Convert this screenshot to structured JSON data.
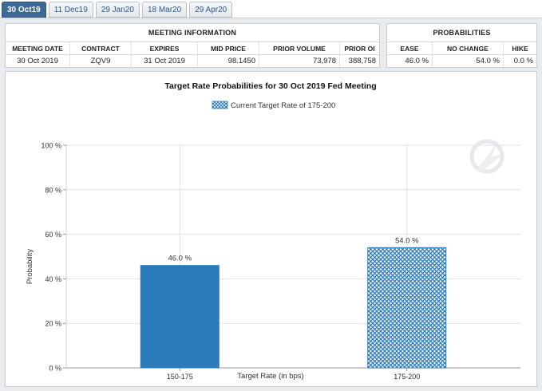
{
  "tabs": [
    {
      "label": "30 Oct19",
      "active": true
    },
    {
      "label": "11 Dec19",
      "active": false
    },
    {
      "label": "29 Jan20",
      "active": false
    },
    {
      "label": "18 Mar20",
      "active": false
    },
    {
      "label": "29 Apr20",
      "active": false
    }
  ],
  "meeting_info": {
    "title": "MEETING INFORMATION",
    "headers": [
      "MEETING DATE",
      "CONTRACT",
      "EXPIRES",
      "MID PRICE",
      "PRIOR VOLUME",
      "PRIOR OI"
    ],
    "row": [
      "30 Oct 2019",
      "ZQV9",
      "31 Oct 2019",
      "98.1450",
      "73,978",
      "388,758"
    ]
  },
  "probabilities": {
    "title": "PROBABILITIES",
    "headers": [
      "EASE",
      "NO CHANGE",
      "HIKE"
    ],
    "row": [
      "46.0 %",
      "54.0 %",
      "0.0 %"
    ]
  },
  "chart_data": {
    "type": "bar",
    "title": "Target Rate Probabilities for 30 Oct 2019 Fed Meeting",
    "legend": "Current Target Rate of 175-200",
    "legend_position": "top-center",
    "categories": [
      "150-175",
      "175-200"
    ],
    "values": [
      46.0,
      54.0
    ],
    "data_labels": [
      "46.0 %",
      "54.0 %"
    ],
    "xlabel": "Target Rate (in bps)",
    "ylabel": "Probability",
    "ylim": [
      0,
      100
    ],
    "yticks": [
      "0 %",
      "20 %",
      "40 %",
      "60 %",
      "80 %",
      "100 %"
    ],
    "grid": true,
    "bar_colors": [
      "#2b7bba",
      "#2b7bba"
    ],
    "bar_styles": [
      "solid",
      "crosshatch"
    ]
  }
}
